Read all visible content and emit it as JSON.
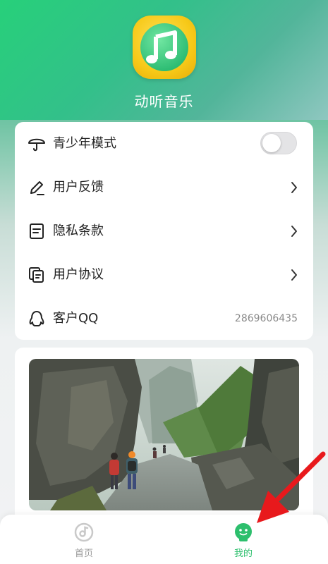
{
  "app": {
    "name": "动听音乐"
  },
  "menu": {
    "items": [
      {
        "label": "青少年模式",
        "icon": "umbrella-icon",
        "control": "toggle",
        "toggle_on": false
      },
      {
        "label": "用户反馈",
        "icon": "pencil-icon",
        "control": "chevron"
      },
      {
        "label": "隐私条款",
        "icon": "document-icon",
        "control": "chevron"
      },
      {
        "label": "用户协议",
        "icon": "copy-document-icon",
        "control": "chevron"
      },
      {
        "label": "客户QQ",
        "icon": "qq-penguin-icon",
        "control": "value",
        "value": "2869606435"
      }
    ]
  },
  "banner": {
    "image": "landscape-photo-canyon-hikers"
  },
  "tabbar": {
    "tabs": [
      {
        "label": "首页",
        "icon": "music-disc-icon",
        "active": false
      },
      {
        "label": "我的",
        "icon": "smiley-face-icon",
        "active": true
      }
    ]
  },
  "annotation": {
    "icon": "red-arrow-pointer",
    "color": "#e8191c"
  },
  "colors": {
    "accent": "#2dbf6d",
    "hero_top": "#27d07a",
    "text_primary": "#222222",
    "text_secondary": "#8a8a8a"
  }
}
